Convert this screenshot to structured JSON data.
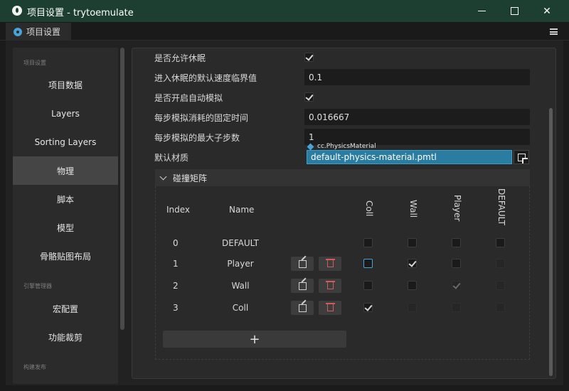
{
  "window": {
    "title": "项目设置 - trytoemulate",
    "minimize_glyph": "",
    "maximize_glyph": "",
    "close_glyph": "✕"
  },
  "tab": {
    "label": "项目设置",
    "icon": "gear-icon"
  },
  "sidebar": {
    "sections": [
      {
        "label": "项目设置"
      },
      {
        "label": "引擎管理器"
      },
      {
        "label": "构建发布"
      }
    ],
    "items": [
      {
        "label": "项目数据",
        "active": false
      },
      {
        "label": "Layers",
        "active": false
      },
      {
        "label": "Sorting Layers",
        "active": false
      },
      {
        "label": "物理",
        "active": true
      },
      {
        "label": "脚本",
        "active": false
      },
      {
        "label": "模型",
        "active": false
      },
      {
        "label": "骨骼贴图布局",
        "active": false
      },
      {
        "label": "宏配置",
        "active": false
      },
      {
        "label": "功能裁剪",
        "active": false
      }
    ]
  },
  "physics": {
    "allow_sleep": {
      "label": "是否允许休眠",
      "checked": true
    },
    "sleep_threshold": {
      "label": "进入休眠的默认速度临界值",
      "value": "0.1"
    },
    "auto_simulation": {
      "label": "是否开启自动模拟",
      "checked": true
    },
    "fixed_time_step": {
      "label": "每步模拟消耗的固定时间",
      "value": "0.016667"
    },
    "max_sub_steps": {
      "label": "每步模拟的最大子步数",
      "value": "1"
    },
    "default_material": {
      "label": "默认材质",
      "type_tag": "cc.PhysicsMaterial",
      "value": "default-physics-material.pmtl"
    }
  },
  "collision": {
    "title": "碰撞矩阵",
    "headers": {
      "index": "Index",
      "name": "Name"
    },
    "columns": [
      "Coll",
      "Wall",
      "Player",
      "DEFAULT"
    ],
    "rows": [
      {
        "index": "0",
        "name": "DEFAULT",
        "checks": [
          false,
          false,
          false,
          false
        ],
        "editable": false
      },
      {
        "index": "1",
        "name": "Player",
        "checks": [
          false,
          true,
          false,
          false
        ],
        "editable": true
      },
      {
        "index": "2",
        "name": "Wall",
        "checks": [
          false,
          false,
          true,
          false
        ],
        "editable": true
      },
      {
        "index": "3",
        "name": "Coll",
        "checks": [
          true,
          false,
          false,
          false
        ],
        "editable": true
      }
    ],
    "add_label": "+"
  }
}
